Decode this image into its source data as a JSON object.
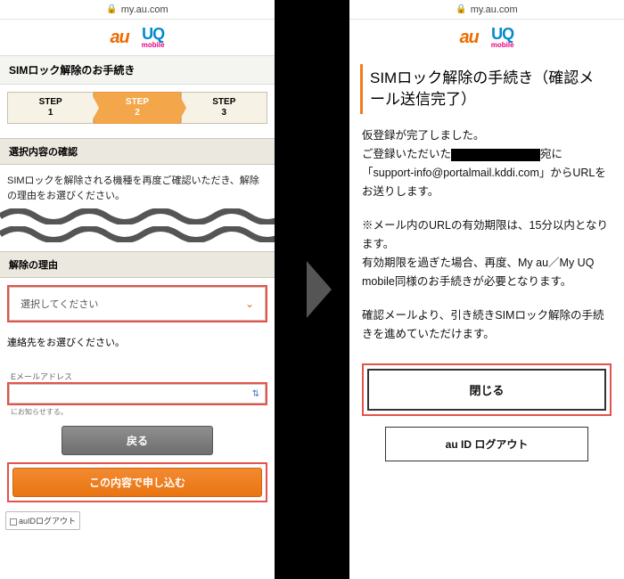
{
  "url": "my.au.com",
  "logos": {
    "au": "au",
    "uq_top": "UQ",
    "uq_bottom": "mobile"
  },
  "left": {
    "page_title": "SIMロック解除のお手続き",
    "steps": [
      {
        "label": "STEP",
        "num": "1"
      },
      {
        "label": "STEP",
        "num": "2"
      },
      {
        "label": "STEP",
        "num": "3"
      }
    ],
    "section_confirm": "選択内容の確認",
    "desc_confirm": "SIMロックを解除される機種を再度ご確認いただき、解除の理由をお選びください。",
    "section_reason": "解除の理由",
    "reason_placeholder": "選択してください",
    "contact_label": "連絡先をお選びください。",
    "email_label": "Eメールアドレス",
    "email_hint": "にお知らせする。",
    "btn_back": "戻る",
    "btn_submit": "この内容で申し込む",
    "logout_mini": "auIDログアウト"
  },
  "right": {
    "title": "SIMロック解除の手続き（確認メール送信完了）",
    "p1a": "仮登録が完了しました。",
    "p1b": "ご登録いただいた",
    "p1c": "宛に「support-info@portalmail.kddi.com」からURLをお送りします。",
    "p2": "※メール内のURLの有効期限は、15分以内となります。",
    "p2b": "有効期限を過ぎた場合、再度、My au／My UQ mobile同様のお手続きが必要となります。",
    "p3": "確認メールより、引き続きSIMロック解除の手続きを進めていただけます。",
    "btn_close": "閉じる",
    "btn_logout": "au ID ログアウト"
  }
}
